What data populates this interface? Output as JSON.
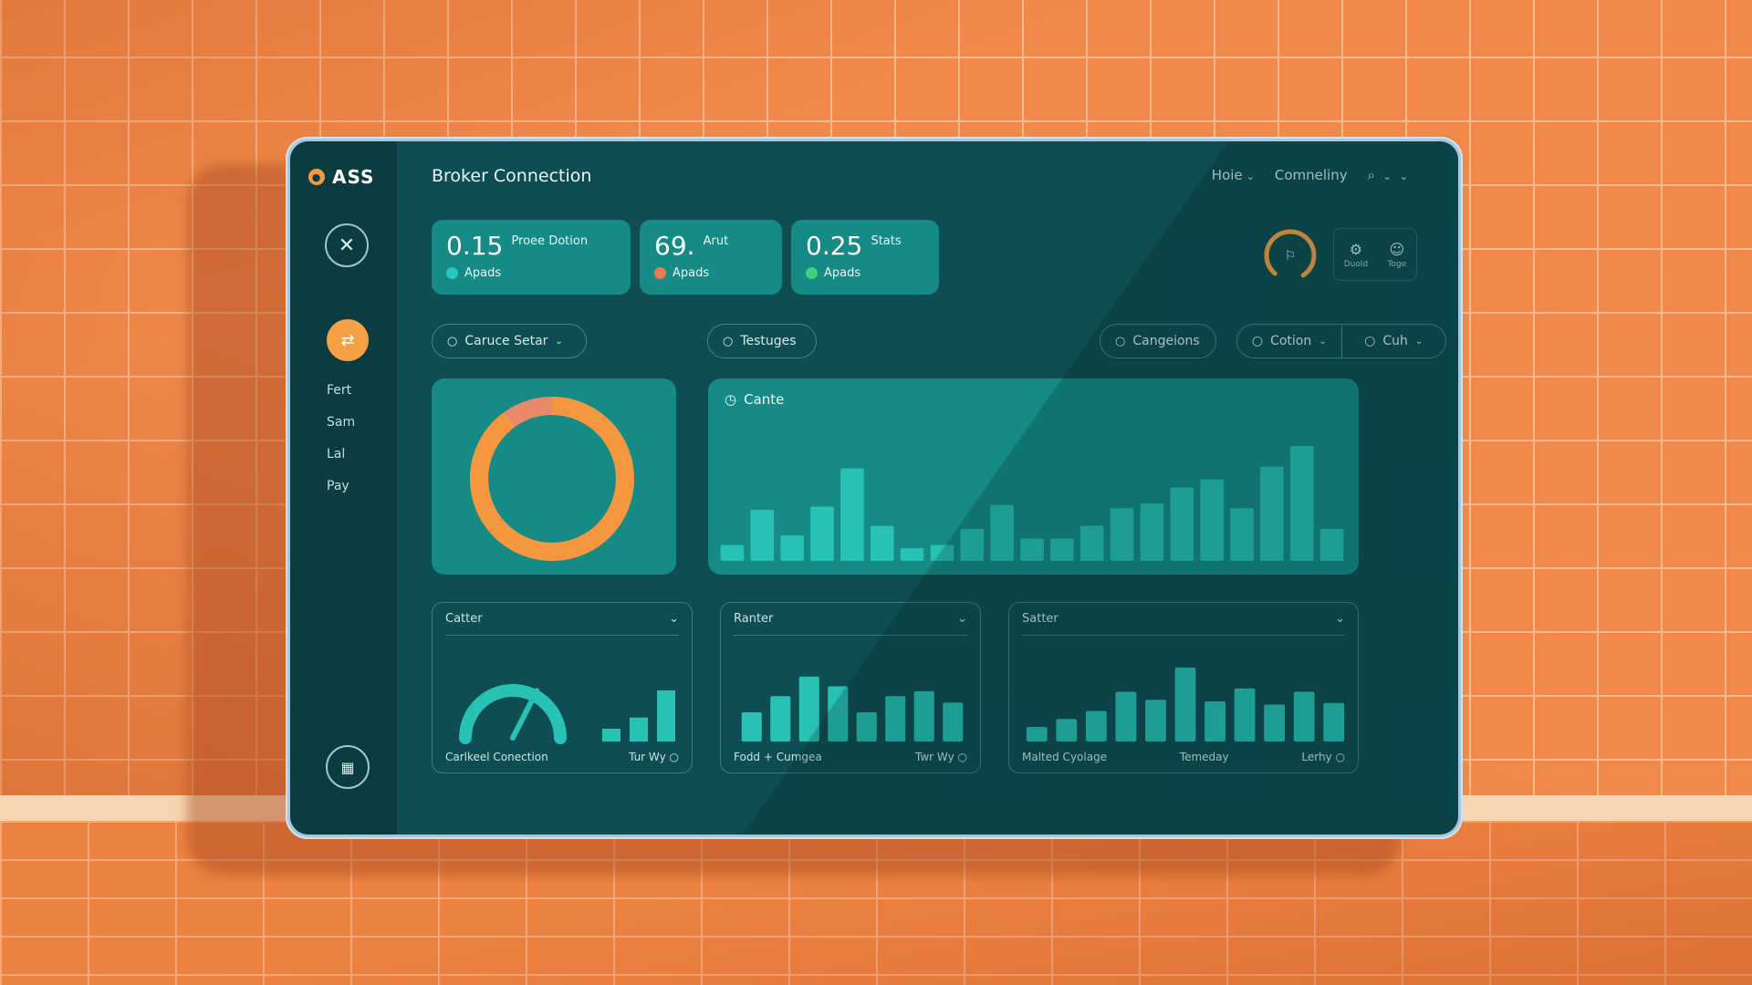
{
  "app": {
    "brand": "ASS",
    "page_title": "Broker Connection"
  },
  "topnav": {
    "home": "Hoie",
    "connecting": "Comneliny"
  },
  "sidebar": {
    "items": [
      "Fert",
      "Sam",
      "Lal",
      "Pay"
    ]
  },
  "stats": [
    {
      "value": "0.15",
      "label": "Proee Dotion",
      "foot": "Apads",
      "dot_color": "#27c8bf"
    },
    {
      "value": "69.",
      "label": "Arut",
      "foot": "Apads",
      "dot_color": "#ec7a4f"
    },
    {
      "value": "0.25",
      "label": "Stats",
      "foot": "Apads",
      "dot_color": "#3ed27a"
    }
  ],
  "tools": [
    {
      "icon": "settings-icon",
      "label": "Duold"
    },
    {
      "icon": "users-icon",
      "label": "Toge"
    }
  ],
  "filters": {
    "carve_selar": "Caruce Setar",
    "testuges": "Testuges",
    "cangeions": "Cangeions",
    "cotion": "Cotion",
    "cuh": "Cuh"
  },
  "donut": {
    "orange_fraction": 0.9,
    "colors": {
      "primary": "#f5973f",
      "secondary": "#e88a6a"
    }
  },
  "bar_panel": {
    "title": "Cante"
  },
  "chart_data": [
    {
      "type": "bar",
      "title": "Cante",
      "values": [
        10,
        32,
        16,
        34,
        58,
        22,
        8,
        10,
        20,
        35,
        14,
        14,
        22,
        33,
        36,
        46,
        51,
        33,
        59,
        72,
        20
      ],
      "ylim": [
        0,
        80
      ],
      "color": "#27c1b5"
    },
    {
      "type": "gauge",
      "title": "Catter",
      "footer": [
        "Carlkeel Conection",
        "Tur Wy"
      ],
      "gauge_fraction": 0.65,
      "bars": [
        8,
        15,
        32
      ],
      "ylim": [
        0,
        40
      ]
    },
    {
      "type": "bar",
      "title": "Ranter",
      "footer": [
        "Fodd + Cumgea",
        "Twr Wy"
      ],
      "values": [
        18,
        28,
        40,
        34,
        18,
        28,
        31,
        24
      ],
      "ylim": [
        0,
        45
      ]
    },
    {
      "type": "bar",
      "title": "Satter",
      "footer": [
        "Malted Cyolage",
        "Temeday",
        "Lerhy"
      ],
      "values": [
        9,
        14,
        19,
        31,
        26,
        46,
        25,
        33,
        23,
        31,
        24
      ],
      "ylim": [
        0,
        50
      ]
    }
  ],
  "colors": {
    "accent": "#f5a044",
    "teal_bar": "#27c1b5",
    "panel": "#168b86",
    "screen": "#0e4d51"
  }
}
